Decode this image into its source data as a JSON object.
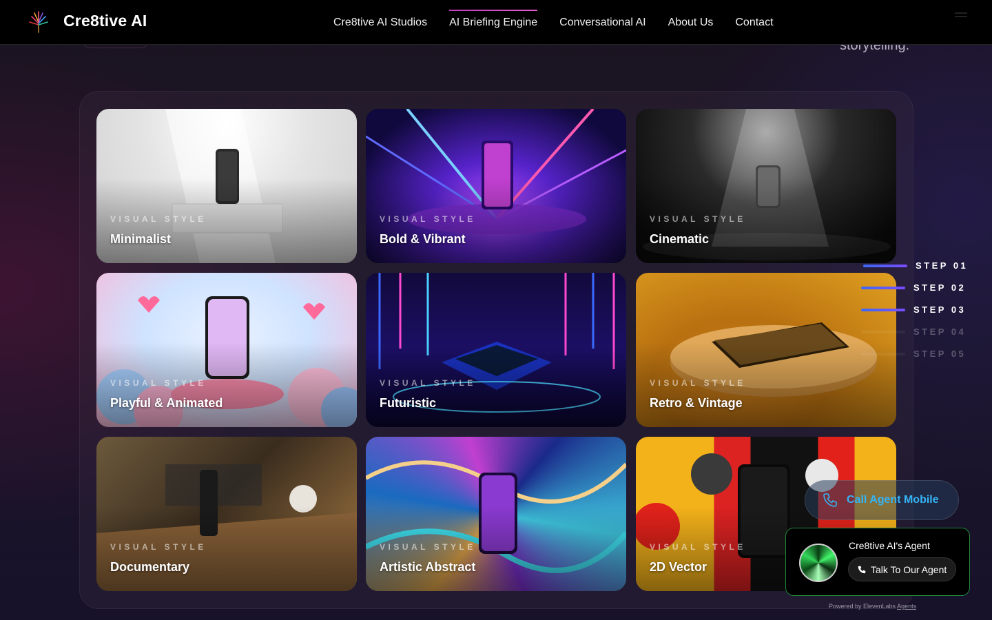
{
  "header": {
    "brand": "Cre8tive AI",
    "nav": [
      {
        "label": "Cre8tive AI Studios",
        "active": false
      },
      {
        "label": "AI Briefing Engine",
        "active": true
      },
      {
        "label": "Conversational AI",
        "active": false
      },
      {
        "label": "About Us",
        "active": false
      },
      {
        "label": "Contact",
        "active": false
      }
    ]
  },
  "hero_fragment": {
    "text": "storytelling."
  },
  "styles_grid": {
    "eyebrow": "VISUAL STYLE",
    "cards": [
      {
        "title": "Minimalist"
      },
      {
        "title": "Bold & Vibrant"
      },
      {
        "title": "Cinematic"
      },
      {
        "title": "Playful & Animated"
      },
      {
        "title": "Futuristic"
      },
      {
        "title": "Retro & Vintage"
      },
      {
        "title": "Documentary"
      },
      {
        "title": "Artistic Abstract"
      },
      {
        "title": "2D Vector"
      }
    ]
  },
  "steps": [
    {
      "label": "STEP 01",
      "active": true
    },
    {
      "label": "STEP 02",
      "active": true
    },
    {
      "label": "STEP 03",
      "active": true
    },
    {
      "label": "STEP 04",
      "active": false
    },
    {
      "label": "STEP 05",
      "active": false
    }
  ],
  "call_mobile": {
    "label": "Call Agent Mobile"
  },
  "agent_widget": {
    "name": "Cre8tive AI's Agent",
    "button": "Talk To Our Agent",
    "powered_by": "Powered by ElevenLabs",
    "powered_link": "Agents"
  },
  "colors": {
    "accent": "#35b4f6",
    "nav_active": "#c43cc1",
    "step_active": "#3b6af5",
    "agent_border": "#1f8a3a"
  }
}
